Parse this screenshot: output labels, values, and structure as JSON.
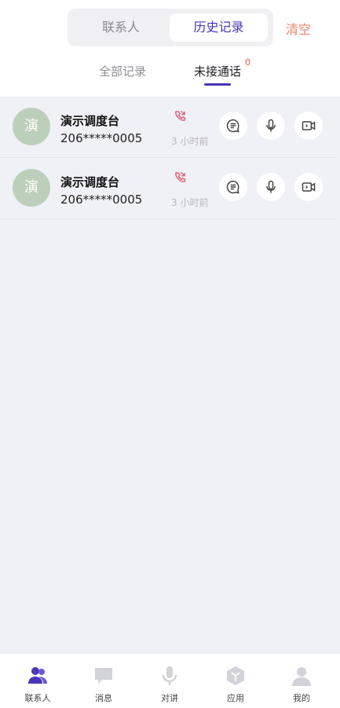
{
  "header": {
    "tab_contacts": "联系人",
    "tab_history": "历史记录",
    "clear_label": "清空"
  },
  "subtabs": {
    "all_label": "全部记录",
    "missed_label": "未接通话",
    "missed_badge": "0"
  },
  "calls": [
    {
      "avatar_text": "演",
      "name": "演示调度台",
      "number": "206*****0005",
      "time": "3 小时前"
    },
    {
      "avatar_text": "演",
      "name": "演示调度台",
      "number": "206*****0005",
      "time": "3 小时前"
    }
  ],
  "bottom_nav": [
    {
      "label": "联系人",
      "icon": "contacts-icon",
      "active": true
    },
    {
      "label": "消息",
      "icon": "message-icon",
      "active": false
    },
    {
      "label": "对讲",
      "icon": "intercom-mic-icon",
      "active": false
    },
    {
      "label": "应用",
      "icon": "apps-icon",
      "active": false
    },
    {
      "label": "我的",
      "icon": "profile-icon",
      "active": false
    }
  ],
  "colors": {
    "accent": "#4a35b8",
    "missed_call": "#e0647a",
    "avatar_bg": "#bccfba",
    "inactive_icon": "#d2d2d9"
  }
}
